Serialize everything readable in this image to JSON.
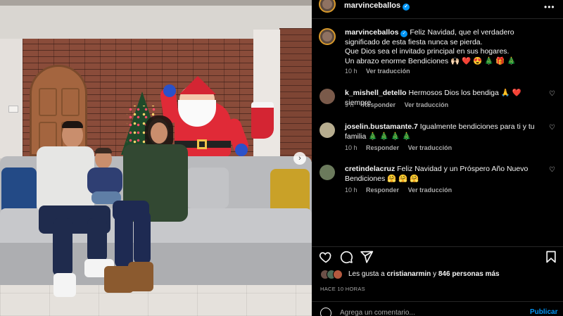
{
  "post": {
    "username": "marvinceballos",
    "caption_username": "marvinceballos",
    "caption_text": "Feliz Navidad, que el verdadero significado de esta fiesta nunca se pierda.",
    "caption_line2": "Que Dios sea el invitado principal en sus hogares.",
    "caption_line3": "Un abrazo enorme Bendiciones 🙌🏻 ❤️ 😍 🎄 🎁 🎄",
    "caption_time": "10 h",
    "caption_translate": "Ver traducción"
  },
  "comments": [
    {
      "username": "k_mishell_detello",
      "text": "Hermosos Dios los bendiga 🙏 ❤️ siempre",
      "time": "9 h",
      "reply": "Responder",
      "translate": "Ver traducción",
      "avatar_color": "#7a5a4a"
    },
    {
      "username": "joselin.bustamante.7",
      "text": "Igualmente bendiciones para ti y tu familia 🎄 🎄 🎄 🎄",
      "time": "10 h",
      "reply": "Responder",
      "translate": "Ver traducción",
      "avatar_color": "#b7ad8f"
    },
    {
      "username": "cretindelacruz",
      "text": "Feliz Navidad y un Próspero Año Nuevo Bendiciones 🤗 🤗 🤗",
      "time": "10 h",
      "reply": "Responder",
      "translate": "Ver traducción",
      "avatar_color": "#6b7a5c"
    }
  ],
  "likes": {
    "prefix": "Les gusta a ",
    "user": "cristianarmin",
    "middle": " y ",
    "count": "846 personas más"
  },
  "time_ago": "HACE 10 HORAS",
  "comment_box": {
    "placeholder": "Agrega un comentario...",
    "post_label": "Publicar"
  },
  "icons": {
    "more": "more-options-icon",
    "like": "heart-icon",
    "comment": "comment-icon",
    "share": "share-icon",
    "save": "bookmark-icon",
    "emoji": "emoji-icon",
    "next": "chevron-right-icon"
  },
  "colors": {
    "accent": "#0095f6",
    "verified": "#0095f6",
    "background": "#000000",
    "secondary_text": "#a8a8a8"
  }
}
